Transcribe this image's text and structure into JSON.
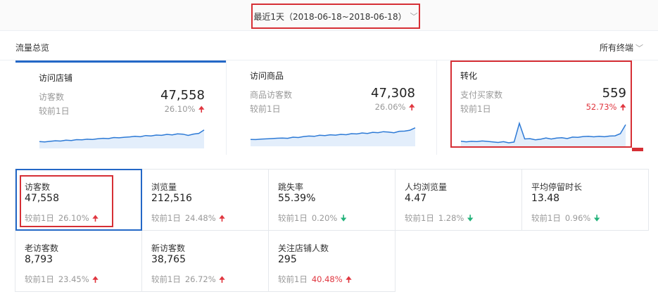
{
  "date_range": {
    "label": "最近1天（2018-06-18~2018-06-18）",
    "chevron_icon": "chevron-down-icon"
  },
  "overview": {
    "section_title": "流量总览",
    "terminal_filter": "所有终端",
    "cards": [
      {
        "title": "访问店铺",
        "metric_label": "访客数",
        "value": "47,558",
        "compare_label": "较前1日",
        "delta": "26.10%",
        "delta_direction": "up",
        "trend": [
          14,
          13.6,
          14.2,
          14.8,
          14.5,
          15.5,
          15.1,
          16,
          15.8,
          16.5,
          16.2,
          17,
          17.5,
          17.2,
          18.3,
          18,
          18.6,
          19,
          19.6,
          19.2,
          20.5,
          20.1,
          21,
          20.7,
          21.8,
          21.2,
          22.3,
          22,
          20.6,
          22.1,
          22.8,
          26.5
        ]
      },
      {
        "title": "访问商品",
        "metric_label": "商品访客数",
        "value": "47,308",
        "compare_label": "较前1日",
        "delta": "26.06%",
        "delta_direction": "up",
        "trend": [
          14,
          13.8,
          14.3,
          14.6,
          14.9,
          15.3,
          15.5,
          15.2,
          16.4,
          16,
          17.1,
          17.6,
          17.3,
          18.5,
          18.1,
          19,
          18.6,
          19.5,
          19.1,
          20.2,
          19.9,
          21,
          20.5,
          21.7,
          21.3,
          22.4,
          21.9,
          21.2,
          22.8,
          23,
          24,
          26.6
        ]
      },
      {
        "title": "转化",
        "metric_label": "支付买家数",
        "value": "559",
        "compare_label": "较前1日",
        "delta": "52.73%",
        "delta_direction": "up",
        "trend": [
          12,
          11.4,
          11.9,
          11.6,
          12.3,
          11.8,
          11.3,
          10.7,
          11.5,
          10.3,
          11.1,
          31.5,
          14.5,
          14.8,
          13.6,
          14.2,
          15.5,
          14.4,
          15.4,
          15.9,
          14.9,
          16.5,
          16.2,
          17.1,
          17.4,
          16.8,
          17.3,
          16.9,
          17.6,
          17.9,
          20.2,
          30
        ]
      }
    ]
  },
  "metrics": [
    {
      "label": "访客数",
      "value": "47,558",
      "compare": "较前1日",
      "pct": "26.10%",
      "direction": "up"
    },
    {
      "label": "浏览量",
      "value": "212,516",
      "compare": "较前1日",
      "pct": "24.48%",
      "direction": "up"
    },
    {
      "label": "跳失率",
      "value": "55.39%",
      "compare": "较前1日",
      "pct": "0.20%",
      "direction": "down"
    },
    {
      "label": "人均浏览量",
      "value": "4.47",
      "compare": "较前1日",
      "pct": "1.28%",
      "direction": "down"
    },
    {
      "label": "平均停留时长",
      "value": "13.48",
      "compare": "较前1日",
      "pct": "0.96%",
      "direction": "down"
    },
    {
      "label": "老访客数",
      "value": "8,793",
      "compare": "较前1日",
      "pct": "23.45%",
      "direction": "up"
    },
    {
      "label": "新访客数",
      "value": "38,765",
      "compare": "较前1日",
      "pct": "26.72%",
      "direction": "up"
    },
    {
      "label": "关注店铺人数",
      "value": "295",
      "compare": "较前1日",
      "pct": "40.48%",
      "direction": "up",
      "pct_color": "#e0363f"
    }
  ],
  "colors": {
    "accent": "#2468c7",
    "highlight": "#d62f35",
    "up": "#e0363f",
    "down": "#23b27a",
    "line": "#2d7ad6",
    "area": "#e3eefb"
  }
}
